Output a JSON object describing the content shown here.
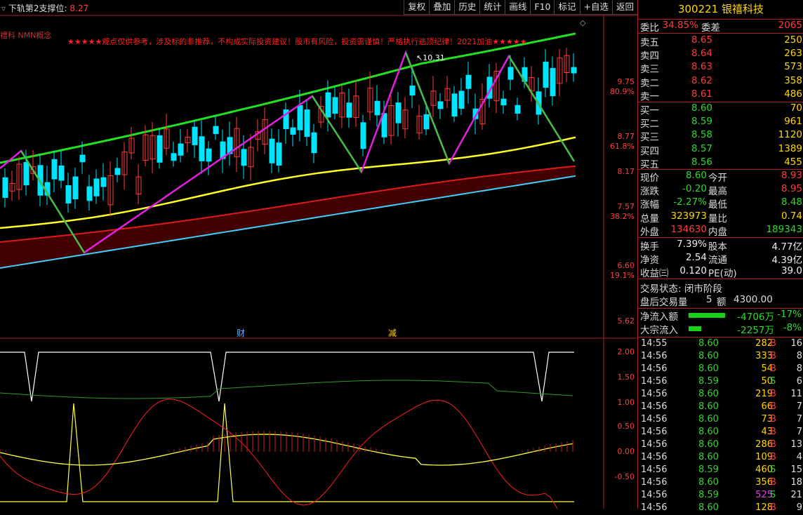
{
  "indicator": {
    "title": "下轨第2支撑位:",
    "value": "8.27"
  },
  "toolbar": [
    "复权",
    "叠加",
    "历史",
    "统计",
    "画线",
    "F10",
    "标记",
    "+自选",
    "返回"
  ],
  "concept_label": "禮科 NMN概念",
  "disclaimer": "★★★★★观点仅供参考，涉及标的非推荐，不构成实际投资建议！股市有风险，投资需谨慎！严格执行逃顶纪律！2021加油★★★★★",
  "diamond": "◇",
  "price_axis": [
    {
      "price": "9.75",
      "pct": "80.9%"
    },
    {
      "price": "8.77",
      "pct": "61.8%"
    },
    {
      "price": "8.17",
      "pct": ""
    },
    {
      "price": "7.57",
      "pct": "38.2%"
    },
    {
      "price": "6.60",
      "pct": "19.1%"
    },
    {
      "price": "5.62",
      "pct": ""
    }
  ],
  "sub_axis": [
    "2.00",
    "1.50",
    "1.00",
    "0.50",
    "0.00",
    "-0.50"
  ],
  "markers": {
    "high_label": "10.31",
    "cai": "财",
    "jian": "减"
  },
  "stock": {
    "code": "300221",
    "name": "银禧科技"
  },
  "quote_header": {
    "wb_label": "委比",
    "wb_val": "34.85%",
    "wc_label": "委差",
    "wc_val": "2065"
  },
  "asks": [
    {
      "label": "卖五",
      "price": "8.65",
      "vol": "250"
    },
    {
      "label": "卖四",
      "price": "8.64",
      "vol": "263"
    },
    {
      "label": "卖三",
      "price": "8.63",
      "vol": "573"
    },
    {
      "label": "卖二",
      "price": "8.62",
      "vol": "358"
    },
    {
      "label": "卖一",
      "price": "8.61",
      "vol": "486"
    }
  ],
  "bids": [
    {
      "label": "买一",
      "price": "8.60",
      "vol": "70"
    },
    {
      "label": "买二",
      "price": "8.59",
      "vol": "961"
    },
    {
      "label": "买三",
      "price": "8.58",
      "vol": "1120"
    },
    {
      "label": "买四",
      "price": "8.57",
      "vol": "1389"
    },
    {
      "label": "买五",
      "price": "8.56",
      "vol": "455"
    }
  ],
  "stats": [
    {
      "l1": "现价",
      "v1": "8.60",
      "c1": "green",
      "l2": "今开",
      "v2": "8.93",
      "c2": "red"
    },
    {
      "l1": "涨跌",
      "v1": "-0.20",
      "c1": "green",
      "l2": "最高",
      "v2": "8.95",
      "c2": "red"
    },
    {
      "l1": "涨幅",
      "v1": "-2.27%",
      "c1": "green",
      "l2": "最低",
      "v2": "8.48",
      "c2": "green"
    },
    {
      "l1": "总量",
      "v1": "323973",
      "c1": "yel",
      "l2": "量比",
      "v2": "0.74",
      "c2": "yel"
    },
    {
      "l1": "外盘",
      "v1": "134630",
      "c1": "red",
      "l2": "内盘",
      "v2": "189343",
      "c2": "green"
    }
  ],
  "fund": [
    {
      "l1": "换手",
      "v1": "7.39%",
      "l2": "股本",
      "v2": "4.77亿"
    },
    {
      "l1": "净资",
      "v1": "2.54",
      "l2": "流通",
      "v2": "4.39亿"
    },
    {
      "l1": "收益㈢",
      "v1": "0.120",
      "l2": "PE(动)",
      "v2": "39.0"
    }
  ],
  "trade_status": "交易状态: 闭市阶段",
  "after_hours": {
    "label": "盘后交易量",
    "vol": "5",
    "amt_label": "额",
    "amt": "4300.00"
  },
  "flows": [
    {
      "label": "净流入额",
      "val": "-4706万",
      "pct": "-17%",
      "bar": 1.0
    },
    {
      "label": "大宗流入",
      "val": "-2257万",
      "pct": "-8%",
      "bar": 0.35
    }
  ],
  "ticks": [
    {
      "time": "14:55",
      "price": "8.60",
      "pc": "green",
      "vol": "282",
      "bs": "B",
      "n": "16"
    },
    {
      "time": "14:56",
      "price": "8.60",
      "pc": "green",
      "vol": "333",
      "bs": "B",
      "n": "8"
    },
    {
      "time": "14:56",
      "price": "8.60",
      "pc": "green",
      "vol": "54",
      "bs": "B",
      "n": "8"
    },
    {
      "time": "14:56",
      "price": "8.59",
      "pc": "green",
      "vol": "50",
      "bs": "S",
      "n": "6"
    },
    {
      "time": "14:56",
      "price": "8.60",
      "pc": "green",
      "vol": "219",
      "bs": "B",
      "n": "11"
    },
    {
      "time": "14:56",
      "price": "8.60",
      "pc": "green",
      "vol": "66",
      "bs": "B",
      "n": "7"
    },
    {
      "time": "14:56",
      "price": "8.60",
      "pc": "green",
      "vol": "73",
      "bs": "B",
      "n": "7"
    },
    {
      "time": "14:56",
      "price": "8.60",
      "pc": "green",
      "vol": "43",
      "bs": "B",
      "n": "7"
    },
    {
      "time": "14:56",
      "price": "8.60",
      "pc": "green",
      "vol": "286",
      "bs": "B",
      "n": "13"
    },
    {
      "time": "14:56",
      "price": "8.60",
      "pc": "green",
      "vol": "109",
      "bs": "B",
      "n": "4"
    },
    {
      "time": "14:56",
      "price": "8.59",
      "pc": "green",
      "vol": "460",
      "bs": "S",
      "n": "15"
    },
    {
      "time": "14:56",
      "price": "8.60",
      "pc": "green",
      "vol": "356",
      "bs": "B",
      "n": "18"
    },
    {
      "time": "14:56",
      "price": "8.59",
      "pc": "green",
      "vol": "525",
      "bs": "S",
      "n": "21"
    },
    {
      "time": "14:56",
      "price": "8.60",
      "pc": "green",
      "vol": "128",
      "bs": "B",
      "n": "9"
    }
  ],
  "colors": {
    "up": "#ff3b3b",
    "down": "#00e5ff",
    "ma_green": "#22e022",
    "ma_yellow": "#ffff20",
    "ma_red": "#e01818",
    "ma_cyan": "#40d0ff",
    "zigzag": "#e020e0",
    "zig_green": "#40c040"
  }
}
